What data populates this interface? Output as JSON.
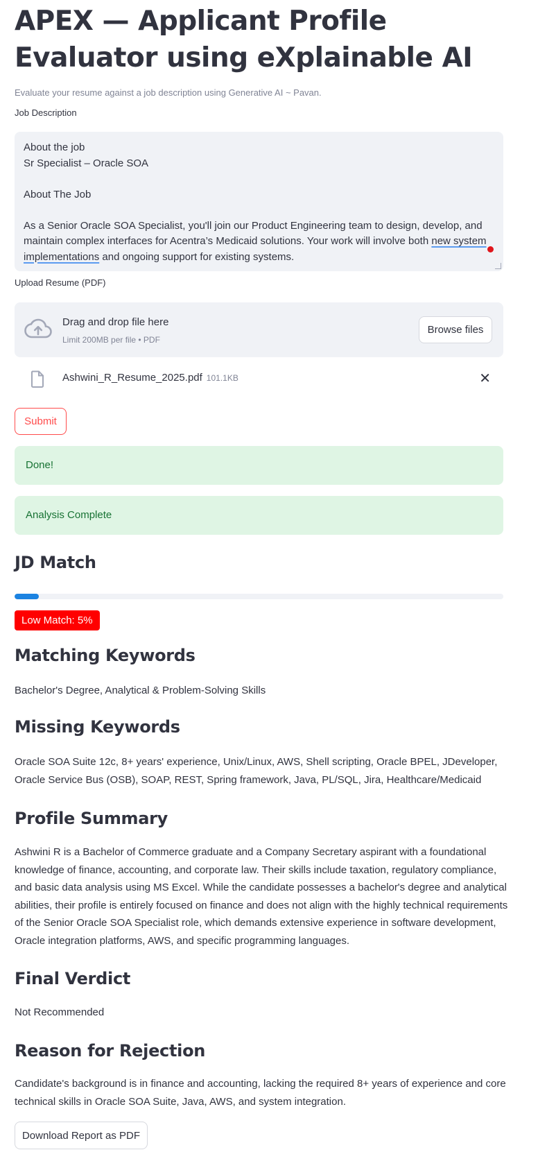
{
  "app": {
    "title": "APEX — Applicant Profile Evaluator using eXplainable AI",
    "caption": "Evaluate your resume against a job description using Generative AI ~ Pavan."
  },
  "jd": {
    "label": "Job Description",
    "line1": "About the job",
    "line2": "Sr Specialist – Oracle SOA",
    "line3": "About The Job",
    "para_a": "As a Senior Oracle SOA Specialist, you'll join our Product Engineering team to design, develop, and maintain complex interfaces for Acentra’s Medicaid solutions. Your work will involve both ",
    "para_misspelled": "new system implementations",
    "para_b": " and ongoing support for existing systems."
  },
  "upload": {
    "label": "Upload Resume (PDF)",
    "drop_text": "Drag and drop file here",
    "limit_text": "Limit 200MB per file • PDF",
    "browse_label": "Browse files",
    "file_name": "Ashwini_R_Resume_2025.pdf",
    "file_size": "101.1KB",
    "close_glyph": "✕"
  },
  "actions": {
    "submit_label": "Submit",
    "download_label": "Download Report as PDF"
  },
  "alerts": {
    "done": "Done!",
    "complete": "Analysis Complete"
  },
  "jd_match": {
    "heading": "JD Match",
    "progress_percent": 5,
    "badge": "Low Match: 5%"
  },
  "matching": {
    "heading": "Matching Keywords",
    "text": "Bachelor's Degree, Analytical & Problem-Solving Skills"
  },
  "missing": {
    "heading": "Missing Keywords",
    "text": "Oracle SOA Suite 12c, 8+ years' experience, Unix/Linux, AWS, Shell scripting, Oracle BPEL, JDeveloper, Oracle Service Bus (OSB), SOAP, REST, Spring framework, Java, PL/SQL, Jira, Healthcare/Medicaid"
  },
  "summary": {
    "heading": "Profile Summary",
    "text": "Ashwini R is a Bachelor of Commerce graduate and a Company Secretary aspirant with a foundational knowledge of finance, accounting, and corporate law. Their skills include taxation, regulatory compliance, and basic data analysis using MS Excel. While the candidate possesses a bachelor's degree and analytical abilities, their profile is entirely focused on finance and does not align with the highly technical requirements of the Senior Oracle SOA Specialist role, which demands extensive experience in software development, Oracle integration platforms, AWS, and specific programming languages."
  },
  "verdict": {
    "heading": "Final Verdict",
    "text": "Not Recommended"
  },
  "rejection": {
    "heading": "Reason for Rejection",
    "text": "Candidate's background is in finance and accounting, lacking the required 8+ years of experience and core technical skills in Oracle SOA Suite, Java, AWS, and system integration."
  },
  "colors": {
    "primary": "#ff4b4b",
    "progress": "#1c83e1",
    "badge_bg": "#ff0000",
    "success_bg": "#dff5e4",
    "success_text": "#177233",
    "input_bg": "#f0f2f6"
  },
  "icons": {
    "upload": "cloud-upload-icon",
    "file": "file-icon",
    "close": "close-icon"
  }
}
